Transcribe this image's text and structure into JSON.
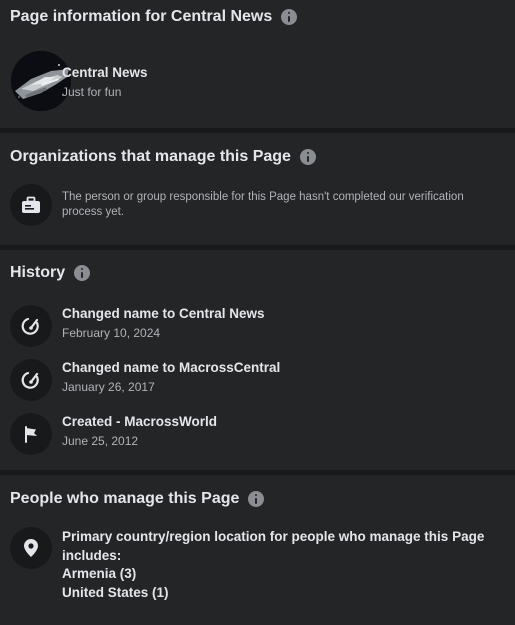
{
  "page_info": {
    "title": "Page information for Central News",
    "name": "Central News",
    "category": "Just for fun"
  },
  "organizations": {
    "title": "Organizations that manage this Page",
    "text": "The person or group responsible for this Page hasn't completed our verification process yet."
  },
  "history": {
    "title": "History",
    "items": [
      {
        "title": "Changed name to Central News",
        "date": "February 10, 2024",
        "icon": "rename-icon"
      },
      {
        "title": "Changed name to MacrossCentral",
        "date": "January 26, 2017",
        "icon": "rename-icon"
      },
      {
        "title": "Created - MacrossWorld",
        "date": "June 25, 2012",
        "icon": "flag-icon"
      }
    ]
  },
  "people": {
    "title": "People who manage this Page",
    "heading": "Primary country/region location for people who manage this Page includes:",
    "locations": [
      "Armenia (3)",
      "United States (1)"
    ]
  },
  "colors": {
    "background": "#18191a",
    "card": "#242526",
    "primary_text": "#e4e6eb",
    "secondary_text": "#b0b3b8",
    "icon_gray": "#8a8d91"
  }
}
